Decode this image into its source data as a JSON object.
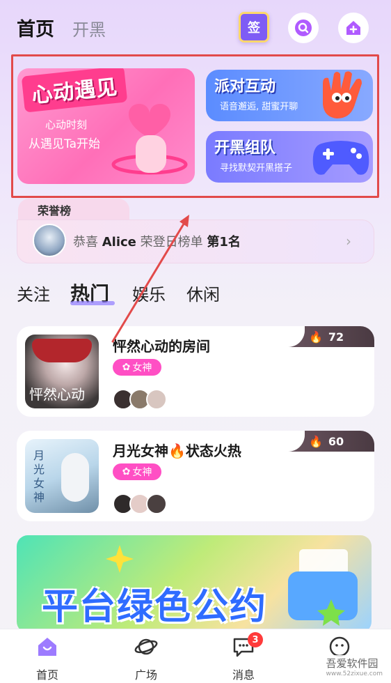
{
  "header": {
    "tabs": [
      "首页",
      "开黑"
    ],
    "sign_label": "签"
  },
  "banner": {
    "left": {
      "title": "心动遇见",
      "sub1": "心动时刻",
      "sub2": "从遇见Ta开始"
    },
    "party": {
      "title": "派对互动",
      "sub": "语音邂逅, 甜蜜开聊"
    },
    "team": {
      "title": "开黑组队",
      "sub": "寻找默契开黑搭子"
    }
  },
  "honor": {
    "title": "荣誉榜",
    "pre": "恭喜 ",
    "name": "Alice",
    "mid": " 荣登日榜单 ",
    "rank": "第1名"
  },
  "categories": [
    "关注",
    "热门",
    "娱乐",
    "休闲"
  ],
  "active_category": "热门",
  "rooms": [
    {
      "name": "怦然心动的房间",
      "tag": "女神",
      "hot": "72",
      "thumb_text": "怦然心动"
    },
    {
      "name": "月光女神🔥状态火热",
      "tag": "女神",
      "hot": "60",
      "thumb_text": "月光女神"
    }
  ],
  "promo": {
    "text": "平台绿色公约"
  },
  "nav": {
    "items": [
      "首页",
      "广场",
      "消息",
      ""
    ],
    "message_badge": "3"
  },
  "watermark": {
    "line1": "吾爱软件园",
    "line2": "www.52zixue.com"
  },
  "colors": {
    "accent": "#8f7bff",
    "tag": "#ff4fc4",
    "highlight_box": "#e24a4a"
  }
}
